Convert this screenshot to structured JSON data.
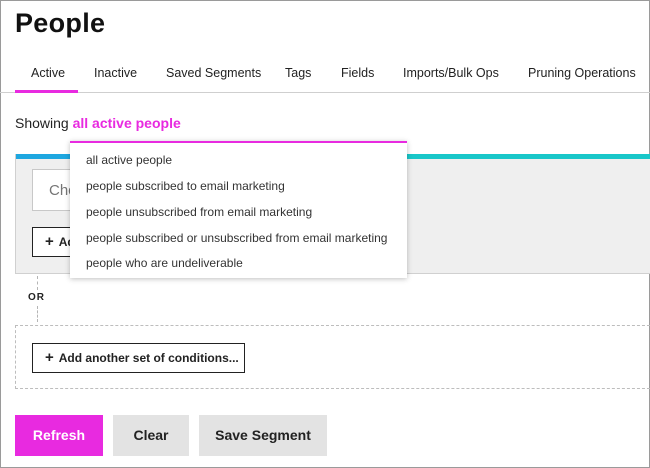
{
  "page": {
    "title": "People"
  },
  "tabs": [
    {
      "label": "Active",
      "active": true
    },
    {
      "label": "Inactive"
    },
    {
      "label": "Saved Segments"
    },
    {
      "label": "Tags"
    },
    {
      "label": "Fields"
    },
    {
      "label": "Imports/Bulk Ops"
    },
    {
      "label": "Pruning Operations"
    }
  ],
  "filter": {
    "prefix": "Showing",
    "selected": "all active people",
    "options": [
      "all active people",
      "people subscribed to email marketing",
      "people unsubscribed from email marketing",
      "people subscribed or unsubscribed from email marketing",
      "people who are undeliverable"
    ]
  },
  "conditions": {
    "choose_placeholder": "Cho",
    "add_condition_label": "Ad",
    "or_label": "OR",
    "add_set_label": "Add another set of conditions..."
  },
  "actions": {
    "refresh": "Refresh",
    "clear": "Clear",
    "save_segment": "Save Segment"
  },
  "colors": {
    "accent": "#e82ae0",
    "teal_bar": "#19c7c9",
    "button_gray": "#e3e3e3"
  }
}
